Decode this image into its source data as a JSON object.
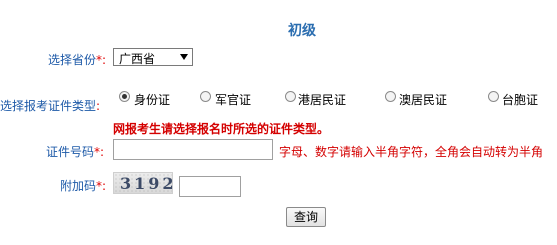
{
  "page": {
    "title": "初级"
  },
  "form": {
    "province": {
      "label": "选择省份",
      "required_mark": "*:",
      "selected": "广西省"
    },
    "id_type": {
      "label": "选择报考证件类型",
      "required_mark": ":",
      "options": [
        "身份证",
        "军官证",
        "港居民证",
        "澳居民证",
        "台胞证"
      ],
      "selected_index": 0
    },
    "notice": "网报考生请选择报名时所选的证件类型。",
    "id_number": {
      "label": "证件号码",
      "required_mark": "*:",
      "value": "",
      "hint": "字母、数字请输入半角字符，全角会自动转为半角"
    },
    "captcha": {
      "label": "附加码",
      "required_mark": "*:",
      "image_text": "3192",
      "value": ""
    },
    "submit_label": "查询"
  }
}
